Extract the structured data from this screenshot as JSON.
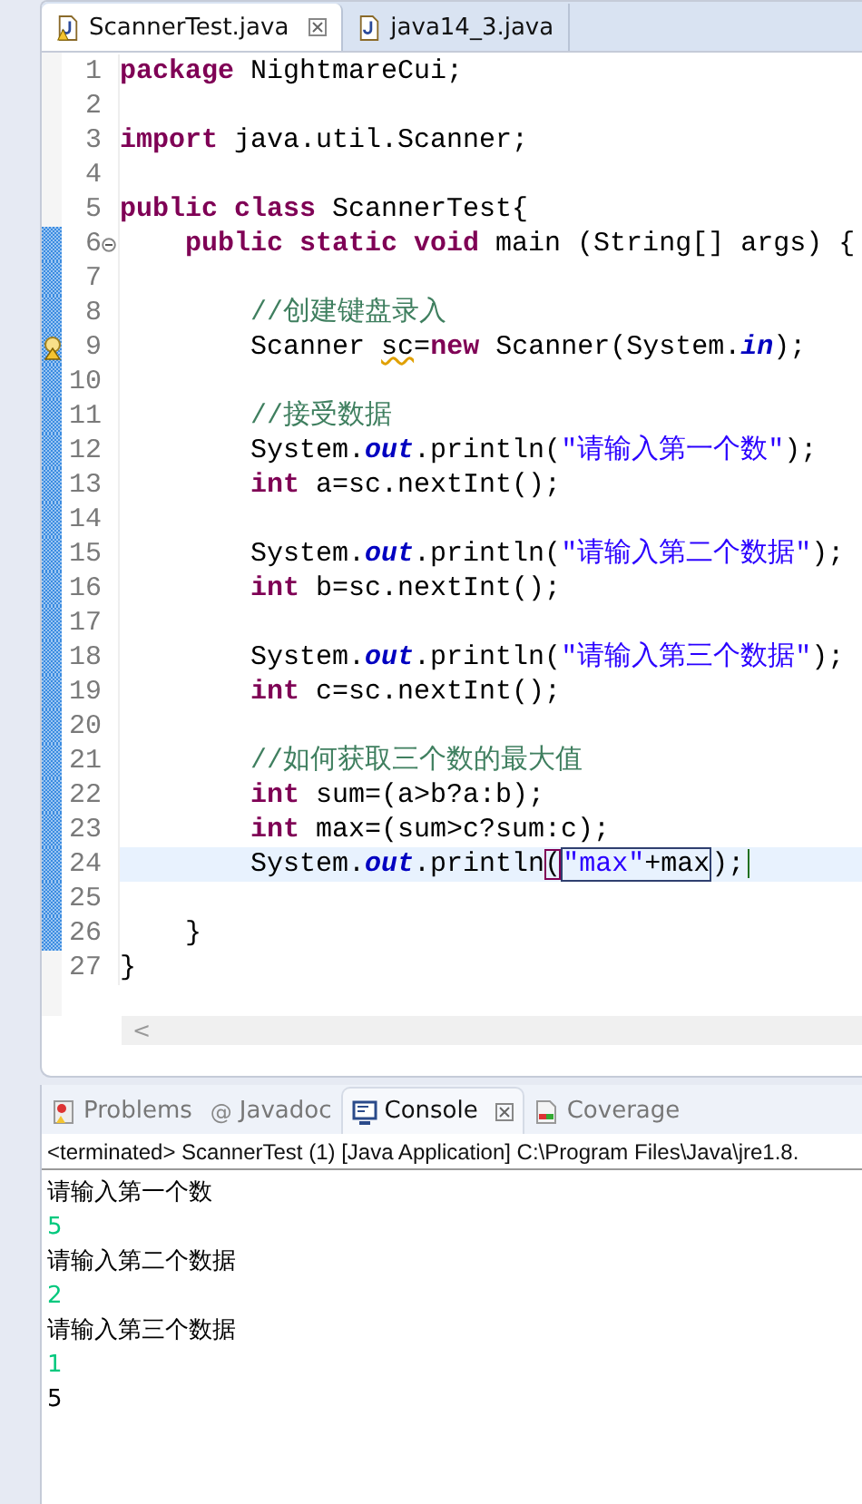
{
  "editor_tabs": [
    {
      "label": "ScannerTest.java",
      "selected": true,
      "warning": true
    },
    {
      "label": "java14_3.java",
      "selected": false,
      "warning": false
    }
  ],
  "code_lines": [
    {
      "number": "1",
      "changed": false,
      "current": false,
      "foldable": false,
      "warning": false,
      "tokens": [
        {
          "kind": "kw",
          "t": "package"
        },
        {
          "kind": "plain",
          "t": " NightmareCui;"
        }
      ]
    },
    {
      "number": "2",
      "changed": false,
      "current": false,
      "foldable": false,
      "warning": false
    },
    {
      "number": "3",
      "changed": false,
      "current": false,
      "foldable": false,
      "warning": false,
      "tokens": [
        {
          "kind": "kw",
          "t": "import"
        },
        {
          "kind": "plain",
          "t": " java.util.Scanner;"
        }
      ]
    },
    {
      "number": "4",
      "changed": false,
      "current": false,
      "foldable": false,
      "warning": false
    },
    {
      "number": "5",
      "changed": false,
      "current": false,
      "foldable": false,
      "warning": false,
      "tokens": [
        {
          "kind": "kw",
          "t": "public class"
        },
        {
          "kind": "plain",
          "t": " ScannerTest{"
        }
      ]
    },
    {
      "number": "6",
      "changed": true,
      "current": false,
      "foldable": true,
      "warning": false,
      "tokens": [
        {
          "kind": "kw",
          "t": "    public static void"
        },
        {
          "kind": "plain",
          "t": " main (String[] args) {"
        }
      ]
    },
    {
      "number": "7",
      "changed": true,
      "current": false,
      "foldable": false,
      "warning": false
    },
    {
      "number": "8",
      "changed": true,
      "current": false,
      "foldable": false,
      "warning": false,
      "tokens": [
        {
          "kind": "comment",
          "t": "        //创建键盘录入"
        }
      ]
    },
    {
      "number": "9",
      "changed": true,
      "current": false,
      "foldable": false,
      "warning": true,
      "tokens": [
        {
          "kind": "plain",
          "t": "        Scanner "
        },
        {
          "kind": "warnvar",
          "t": "sc"
        },
        {
          "kind": "plain",
          "t": "="
        },
        {
          "kind": "kw",
          "t": "new"
        },
        {
          "kind": "plain",
          "t": " Scanner(System."
        },
        {
          "kind": "static",
          "t": "in"
        },
        {
          "kind": "plain",
          "t": ");"
        }
      ]
    },
    {
      "number": "10",
      "changed": true,
      "current": false,
      "foldable": false,
      "warning": false
    },
    {
      "number": "11",
      "changed": true,
      "current": false,
      "foldable": false,
      "warning": false,
      "tokens": [
        {
          "kind": "comment",
          "t": "        //接受数据"
        }
      ]
    },
    {
      "number": "12",
      "changed": true,
      "current": false,
      "foldable": false,
      "warning": false,
      "tokens": [
        {
          "kind": "plain",
          "t": "        System."
        },
        {
          "kind": "static",
          "t": "out"
        },
        {
          "kind": "plain",
          "t": ".println("
        },
        {
          "kind": "string",
          "t": "\"请输入第一个数\""
        },
        {
          "kind": "plain",
          "t": ");"
        }
      ]
    },
    {
      "number": "13",
      "changed": true,
      "current": false,
      "foldable": false,
      "warning": false,
      "tokens": [
        {
          "kind": "kw",
          "t": "        int"
        },
        {
          "kind": "plain",
          "t": " a=sc.nextInt();"
        }
      ]
    },
    {
      "number": "14",
      "changed": true,
      "current": false,
      "foldable": false,
      "warning": false
    },
    {
      "number": "15",
      "changed": true,
      "current": false,
      "foldable": false,
      "warning": false,
      "tokens": [
        {
          "kind": "plain",
          "t": "        System."
        },
        {
          "kind": "static",
          "t": "out"
        },
        {
          "kind": "plain",
          "t": ".println("
        },
        {
          "kind": "string",
          "t": "\"请输入第二个数据\""
        },
        {
          "kind": "plain",
          "t": ");"
        }
      ]
    },
    {
      "number": "16",
      "changed": true,
      "current": false,
      "foldable": false,
      "warning": false,
      "tokens": [
        {
          "kind": "kw",
          "t": "        int"
        },
        {
          "kind": "plain",
          "t": " b=sc.nextInt();"
        }
      ]
    },
    {
      "number": "17",
      "changed": true,
      "current": false,
      "foldable": false,
      "warning": false
    },
    {
      "number": "18",
      "changed": true,
      "current": false,
      "foldable": false,
      "warning": false,
      "tokens": [
        {
          "kind": "plain",
          "t": "        System."
        },
        {
          "kind": "static",
          "t": "out"
        },
        {
          "kind": "plain",
          "t": ".println("
        },
        {
          "kind": "string",
          "t": "\"请输入第三个数据\""
        },
        {
          "kind": "plain",
          "t": ");"
        }
      ]
    },
    {
      "number": "19",
      "changed": true,
      "current": false,
      "foldable": false,
      "warning": false,
      "tokens": [
        {
          "kind": "kw",
          "t": "        int"
        },
        {
          "kind": "plain",
          "t": " c=sc.nextInt();"
        }
      ]
    },
    {
      "number": "20",
      "changed": true,
      "current": false,
      "foldable": false,
      "warning": false
    },
    {
      "number": "21",
      "changed": true,
      "current": false,
      "foldable": false,
      "warning": false,
      "tokens": [
        {
          "kind": "comment",
          "t": "        //如何获取三个数的最大值"
        }
      ]
    },
    {
      "number": "22",
      "changed": true,
      "current": false,
      "foldable": false,
      "warning": false,
      "tokens": [
        {
          "kind": "kw",
          "t": "        int"
        },
        {
          "kind": "plain",
          "t": " sum=(a>b?a:b);"
        }
      ]
    },
    {
      "number": "23",
      "changed": true,
      "current": false,
      "foldable": false,
      "warning": false,
      "tokens": [
        {
          "kind": "kw",
          "t": "        int"
        },
        {
          "kind": "plain",
          "t": " max=(sum>c?sum:c);"
        }
      ]
    },
    {
      "number": "24",
      "changed": true,
      "current": true,
      "foldable": false,
      "warning": false,
      "tokens": [
        {
          "kind": "plain",
          "t": "        System."
        },
        {
          "kind": "static",
          "t": "out"
        },
        {
          "kind": "plain",
          "t": ".println"
        },
        {
          "kind": "match",
          "t": "("
        },
        {
          "kind": "strbox",
          "t": "\"max\""
        },
        {
          "kind": "boxend",
          "t": "+max"
        },
        {
          "kind": "plain",
          "t": ");"
        }
      ]
    },
    {
      "number": "25",
      "changed": true,
      "current": false,
      "foldable": false,
      "warning": false
    },
    {
      "number": "26",
      "changed": true,
      "current": false,
      "foldable": false,
      "warning": false,
      "tokens": [
        {
          "kind": "plain",
          "t": "    }"
        }
      ]
    },
    {
      "number": "27",
      "changed": false,
      "current": false,
      "foldable": false,
      "warning": false,
      "tokens": [
        {
          "kind": "plain",
          "t": "}"
        }
      ]
    }
  ],
  "scroll_arrow": "<",
  "panel_tabs": [
    {
      "label": "Problems",
      "kind": "problems",
      "selected": false
    },
    {
      "label": "Javadoc",
      "kind": "javadoc",
      "glyph": "@",
      "selected": false
    },
    {
      "label": "Console",
      "kind": "console",
      "selected": true
    },
    {
      "label": "Coverage",
      "kind": "coverage",
      "selected": false
    }
  ],
  "console_description": "<terminated> ScannerTest (1) [Java Application] C:\\Program Files\\Java\\jre1.8.",
  "console_lines": [
    {
      "text": "请输入第一个数",
      "kind": "output"
    },
    {
      "text": "5",
      "kind": "input"
    },
    {
      "text": "请输入第二个数据",
      "kind": "output"
    },
    {
      "text": "2",
      "kind": "input"
    },
    {
      "text": "请输入第三个数据",
      "kind": "output"
    },
    {
      "text": "1",
      "kind": "input"
    },
    {
      "text": "5",
      "kind": "output"
    }
  ]
}
